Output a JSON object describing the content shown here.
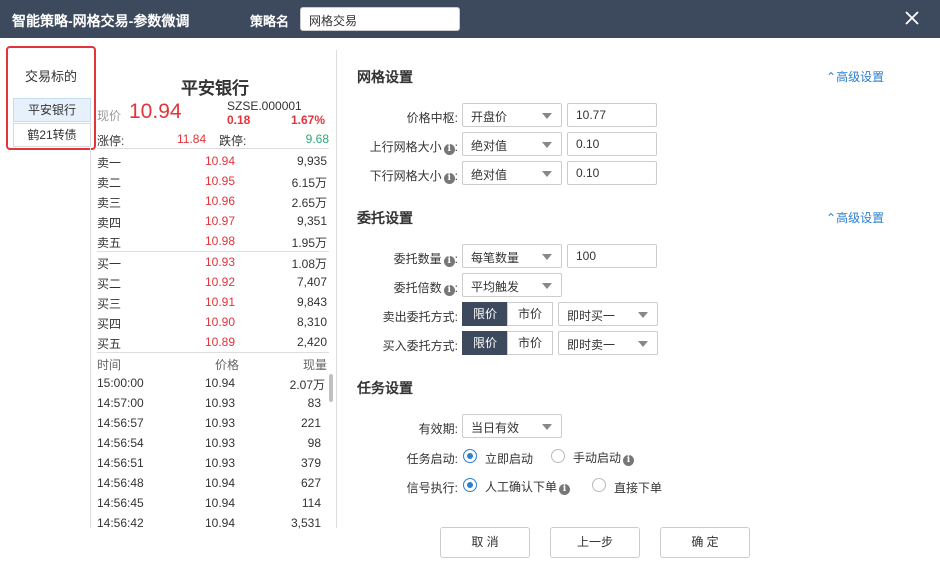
{
  "titlebar": {
    "title": "智能策略-网格交易-参数微调",
    "name_label": "策略名",
    "name_value": "网格交易"
  },
  "target_panel": {
    "title": "交易标的",
    "items": [
      "平安银行",
      "鹤21转债"
    ]
  },
  "quote": {
    "stock_name": "平安银行",
    "now_label": "现价",
    "now_price": "10.94",
    "code": "SZSE.000001",
    "change": "0.18",
    "change_pct": "1.67%",
    "limit_up_label": "涨停:",
    "limit_up": "11.84",
    "limit_down_label": "跌停:",
    "limit_down": "9.68",
    "asks": [
      {
        "label": "卖一",
        "price": "10.94",
        "volume": "9,935"
      },
      {
        "label": "卖二",
        "price": "10.95",
        "volume": "6.15万"
      },
      {
        "label": "卖三",
        "price": "10.96",
        "volume": "2.65万"
      },
      {
        "label": "卖四",
        "price": "10.97",
        "volume": "9,351"
      },
      {
        "label": "卖五",
        "price": "10.98",
        "volume": "1.95万"
      }
    ],
    "bids": [
      {
        "label": "买一",
        "price": "10.93",
        "volume": "1.08万"
      },
      {
        "label": "买二",
        "price": "10.92",
        "volume": "7,407"
      },
      {
        "label": "买三",
        "price": "10.91",
        "volume": "9,843"
      },
      {
        "label": "买四",
        "price": "10.90",
        "volume": "8,310"
      },
      {
        "label": "买五",
        "price": "10.89",
        "volume": "2,420"
      }
    ],
    "trades_header": {
      "time": "时间",
      "price": "价格",
      "volume": "现量"
    },
    "trades": [
      {
        "time": "15:00:00",
        "price": "10.94",
        "volume": "2.07万"
      },
      {
        "time": "14:57:00",
        "price": "10.93",
        "volume": "83"
      },
      {
        "time": "14:56:57",
        "price": "10.93",
        "volume": "221"
      },
      {
        "time": "14:56:54",
        "price": "10.93",
        "volume": "98"
      },
      {
        "time": "14:56:51",
        "price": "10.93",
        "volume": "379"
      },
      {
        "time": "14:56:48",
        "price": "10.94",
        "volume": "627"
      },
      {
        "time": "14:56:45",
        "price": "10.94",
        "volume": "114"
      },
      {
        "time": "14:56:42",
        "price": "10.94",
        "volume": "3,531"
      }
    ]
  },
  "grid": {
    "title": "网格设置",
    "advanced": "高级设置",
    "center_label": "价格中枢:",
    "center_mode": "开盘价",
    "center_value": "10.77",
    "up_label": "上行网格大小",
    "up_mode": "绝对值",
    "up_value": "0.10",
    "down_label": "下行网格大小",
    "down_mode": "绝对值",
    "down_value": "0.10"
  },
  "order": {
    "title": "委托设置",
    "advanced": "高级设置",
    "qty_label": "委托数量",
    "qty_mode": "每笔数量",
    "qty_value": "100",
    "mult_label": "委托倍数",
    "mult_mode": "平均触发",
    "sell_label": "卖出委托方式:",
    "buy_label": "买入委托方式:",
    "limit": "限价",
    "market": "市价",
    "sell_price_mode": "即时买一",
    "buy_price_mode": "即时卖一"
  },
  "task": {
    "title": "任务设置",
    "valid_label": "有效期:",
    "valid_value": "当日有效",
    "start_label": "任务启动:",
    "start_now": "立即启动",
    "start_manual": "手动启动",
    "signal_label": "信号执行:",
    "signal_confirm": "人工确认下单",
    "signal_direct": "直接下单"
  },
  "buttons": {
    "cancel": "取 消",
    "prev": "上一步",
    "ok": "确 定"
  },
  "colors": {
    "up": "#e3343a",
    "down": "#2aa876",
    "accent": "#2d7fd0",
    "header": "#3d4a5d"
  }
}
